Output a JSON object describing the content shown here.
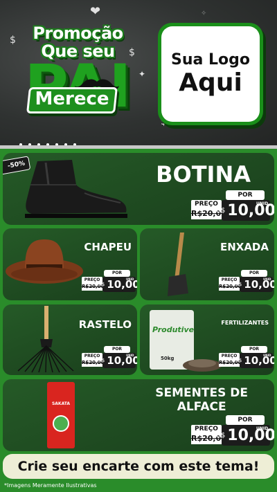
{
  "header": {
    "title_line1": "Promoção",
    "title_line2": "Que seu",
    "title_big": "PAI",
    "title_badge": "Merece",
    "logo_line1": "Sua Logo",
    "logo_line2": "Aqui"
  },
  "products": [
    {
      "name": "BOTINA",
      "discount": "-50%",
      "por": "POR",
      "preco": "PREÇO",
      "old_price": "R$20,00",
      "currency": "R$",
      "price": "10,00",
      "unit": "UNID"
    },
    {
      "name": "CHAPEU",
      "por": "POR",
      "preco": "PREÇO",
      "old_price": "R$20,00",
      "currency": "R$",
      "price": "10,00",
      "unit": "UNID"
    },
    {
      "name": "ENXADA",
      "por": "POR",
      "preco": "PREÇO",
      "old_price": "R$20,00",
      "currency": "R$",
      "price": "10,00",
      "unit": "UNID"
    },
    {
      "name": "RASTELO",
      "por": "POR",
      "preco": "PREÇO",
      "old_price": "R$20,00",
      "currency": "R$",
      "price": "10,00",
      "unit": "UNID"
    },
    {
      "name": "FERTILIZANTES",
      "package_brand": "Produtive",
      "package_weight": "50kg",
      "por": "POR",
      "preco": "PREÇO",
      "old_price": "R$20,00",
      "currency": "R$",
      "price": "10,00",
      "unit": "UNID"
    },
    {
      "name_line1": "SEMENTES DE",
      "name_line2": "ALFACE",
      "package_brand": "SAKATA",
      "por": "POR",
      "preco": "PREÇO",
      "old_price": "R$20,00",
      "currency": "R$",
      "price": "10,00",
      "unit": "UNID"
    }
  ],
  "cta": "Crie seu encarte com este tema!",
  "disclaimer": "*Imagens Meramente Ilustrativas",
  "colors": {
    "brand_green": "#1fa11f",
    "card_dark": "#1f4a22",
    "background_green": "#2a8c2a",
    "cta_bg": "#eeeed6"
  }
}
